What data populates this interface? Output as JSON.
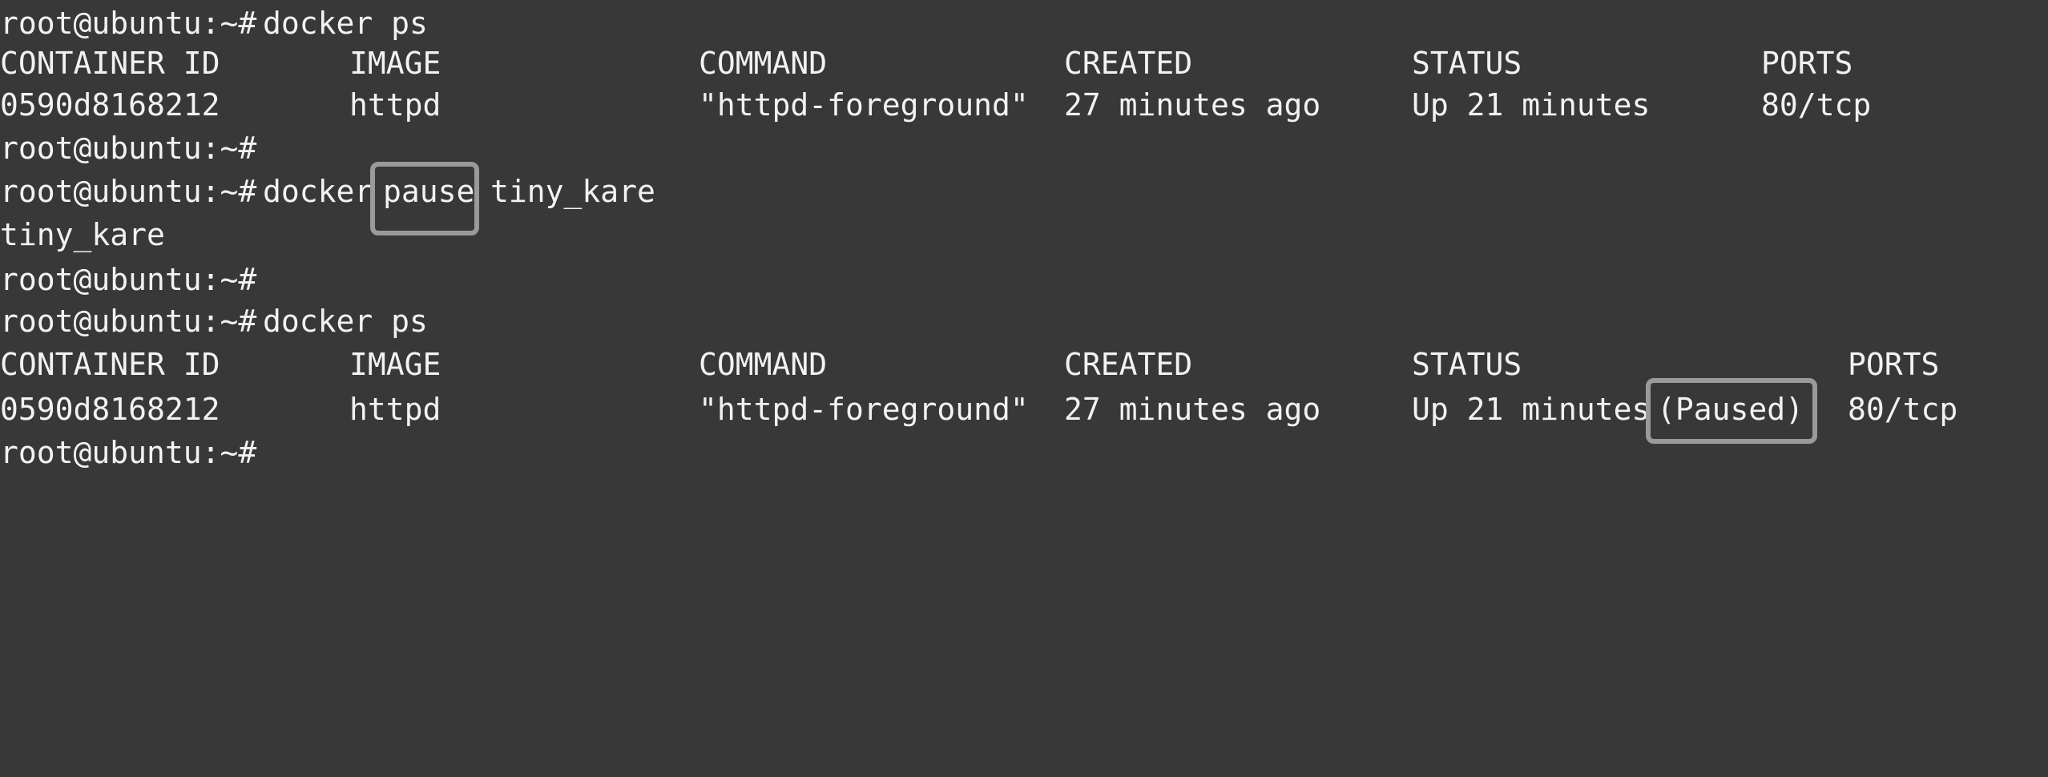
{
  "colors": {
    "background": "#383838",
    "text": "#f2f2f2",
    "highlight_border": "#9a9a9a"
  },
  "lines": [
    {
      "prompt": "root@ubuntu:~#",
      "command": "docker ps"
    },
    {
      "headers": [
        "CONTAINER ID",
        "IMAGE",
        "COMMAND",
        "CREATED",
        "STATUS",
        "PORTS"
      ]
    },
    {
      "row": [
        "0590d8168212",
        "httpd",
        "\"httpd-foreground\"",
        "27 minutes ago",
        "Up 21 minutes",
        "80/tcp"
      ]
    },
    {
      "prompt": "root@ubuntu:~#"
    },
    {
      "prompt": "root@ubuntu:~#",
      "cmd_pre": "docker",
      "cmd_highlight": "pause",
      "cmd_post": "tiny_kare"
    },
    {
      "output": "tiny_kare"
    },
    {
      "prompt": "root@ubuntu:~#"
    },
    {
      "prompt": "root@ubuntu:~#",
      "command": "docker ps"
    },
    {
      "headers": [
        "CONTAINER ID",
        "IMAGE",
        "COMMAND",
        "CREATED",
        "STATUS",
        "PORTS"
      ]
    },
    {
      "row": [
        "0590d8168212",
        "httpd",
        "\"httpd-foreground\"",
        "27 minutes ago",
        "Up 21 minutes",
        "(Paused)",
        "80/tcp"
      ]
    },
    {
      "prompt": "root@ubuntu:~#"
    }
  ]
}
